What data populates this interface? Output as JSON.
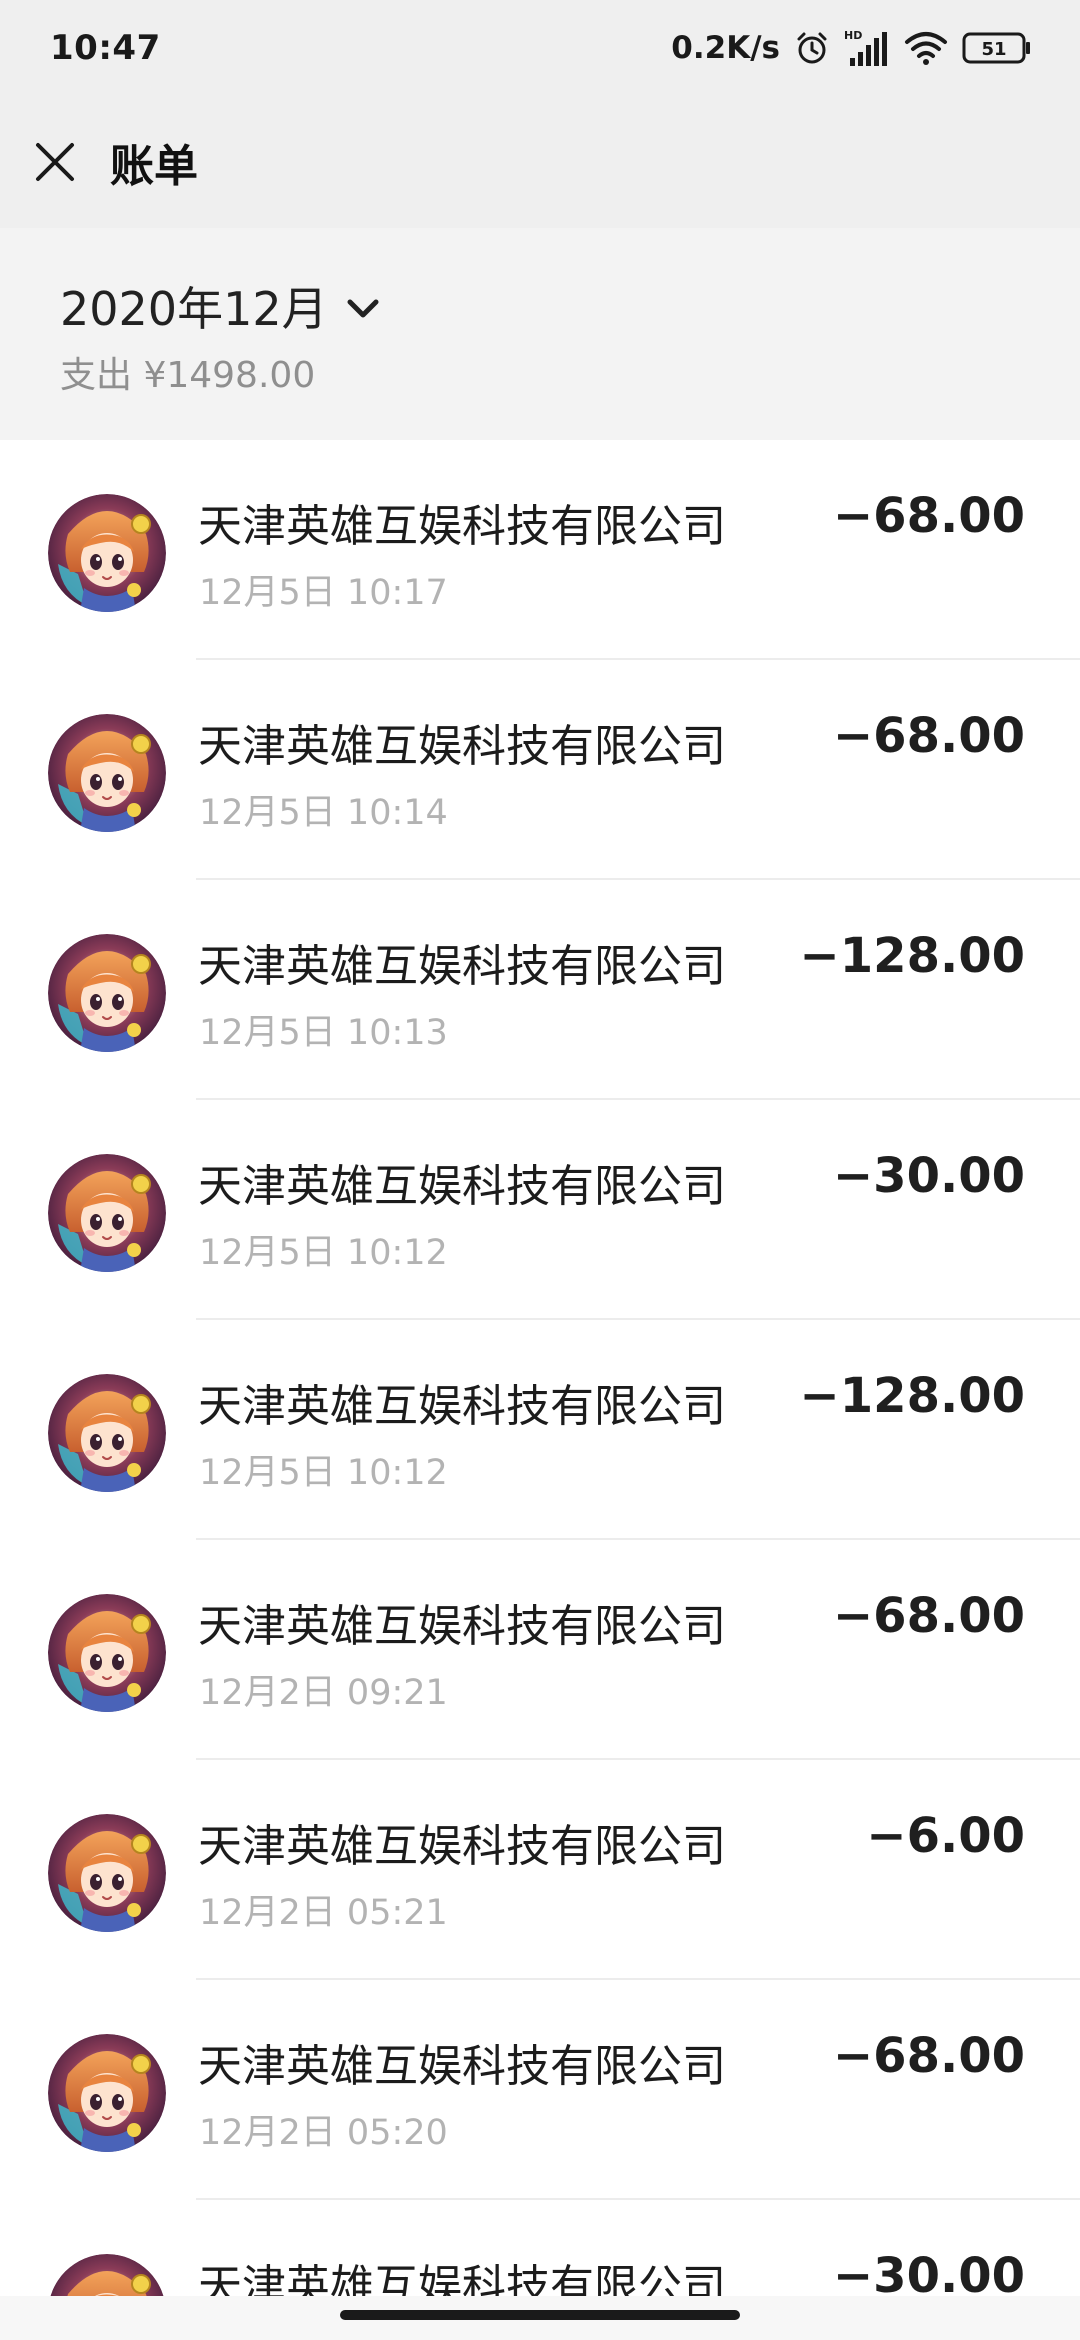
{
  "status_bar": {
    "time": "10:47",
    "net_speed": "0.2K/s",
    "hd_label": "HD",
    "battery": "51",
    "icons": [
      "alarm-icon",
      "signal-icon",
      "wifi-icon",
      "battery-icon"
    ]
  },
  "header": {
    "title": "账单",
    "close_icon": "close-icon"
  },
  "summary": {
    "month": "2020年12月",
    "expense": "支出 ¥1498.00"
  },
  "transactions": [
    {
      "name": "天津英雄互娱科技有限公司",
      "time": "12月5日 10:17",
      "amount": "−68.00"
    },
    {
      "name": "天津英雄互娱科技有限公司",
      "time": "12月5日 10:14",
      "amount": "−68.00"
    },
    {
      "name": "天津英雄互娱科技有限公司",
      "time": "12月5日 10:13",
      "amount": "−128.00"
    },
    {
      "name": "天津英雄互娱科技有限公司",
      "time": "12月5日 10:12",
      "amount": "−30.00"
    },
    {
      "name": "天津英雄互娱科技有限公司",
      "time": "12月5日 10:12",
      "amount": "−128.00"
    },
    {
      "name": "天津英雄互娱科技有限公司",
      "time": "12月2日 09:21",
      "amount": "−68.00"
    },
    {
      "name": "天津英雄互娱科技有限公司",
      "time": "12月2日 05:21",
      "amount": "−6.00"
    },
    {
      "name": "天津英雄互娱科技有限公司",
      "time": "12月2日 05:20",
      "amount": "−68.00"
    },
    {
      "name": "天津英雄互娱科技有限公司",
      "time": "",
      "amount": "−30.00"
    }
  ]
}
